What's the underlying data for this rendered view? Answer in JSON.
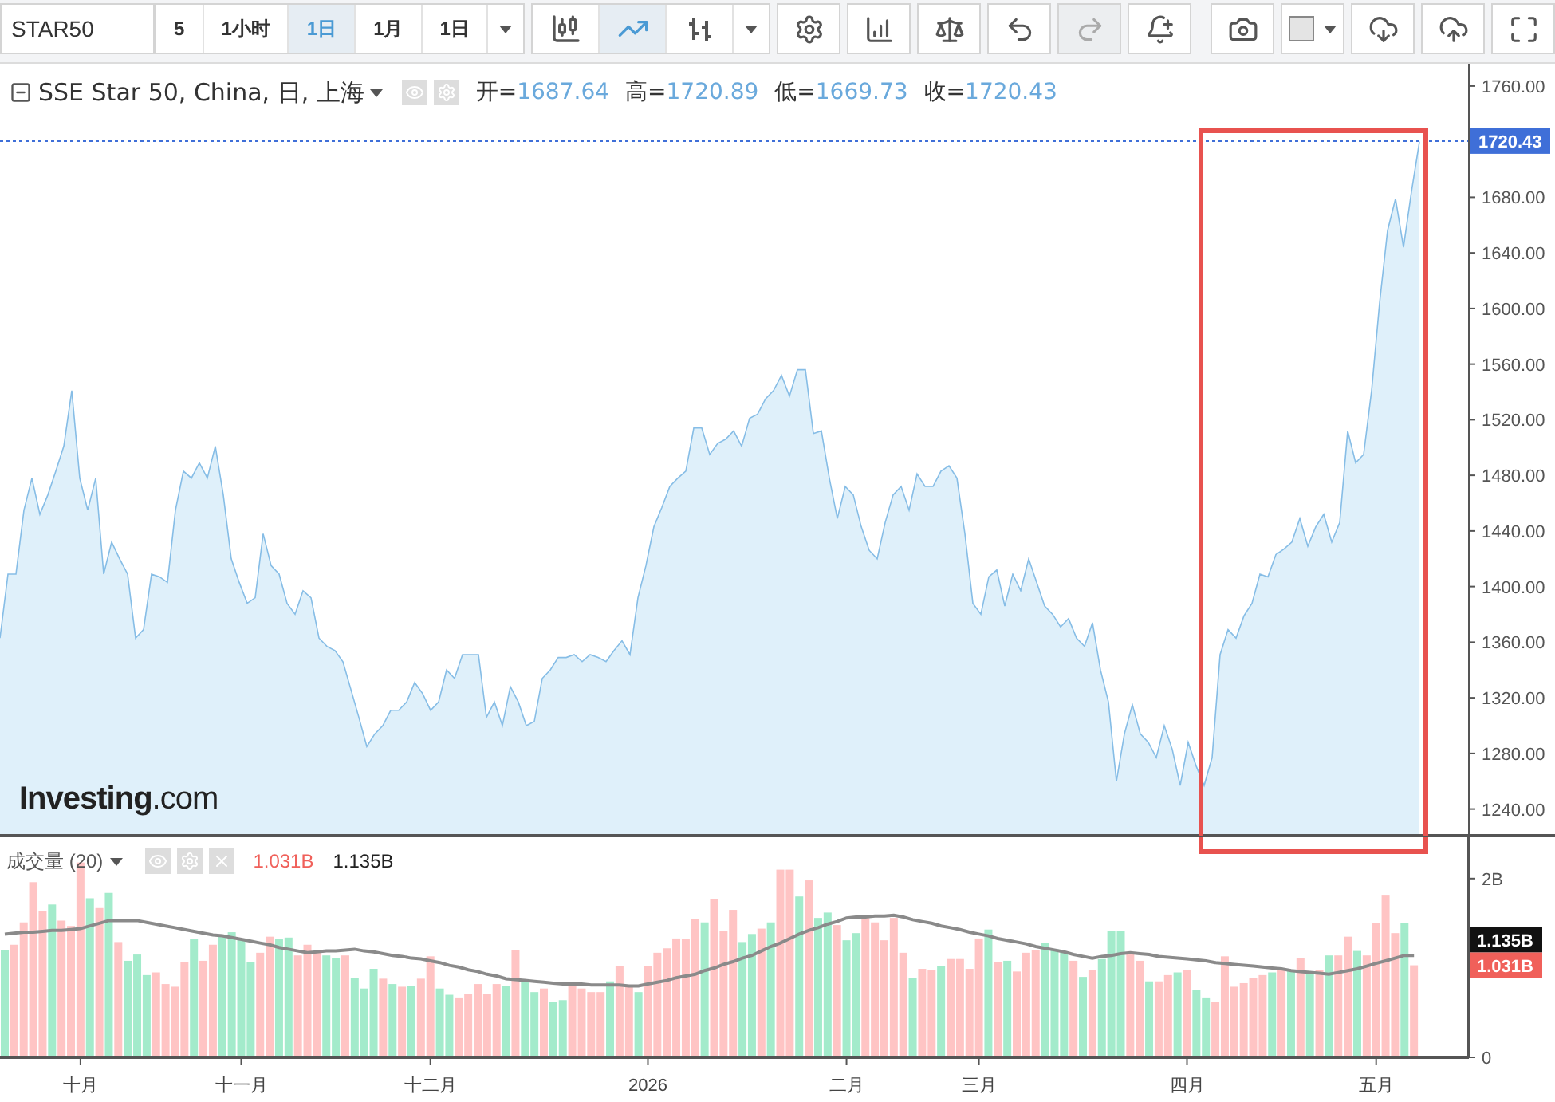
{
  "toolbar": {
    "symbol": "STAR50",
    "intervals": [
      {
        "label": "5",
        "selected": false
      },
      {
        "label": "1小时",
        "selected": false
      },
      {
        "label": "1日",
        "selected": true
      },
      {
        "label": "1月",
        "selected": false
      },
      {
        "label": "1日",
        "selected": false
      }
    ],
    "chart_types": [
      {
        "kind": "candles",
        "selected": false
      },
      {
        "kind": "line",
        "selected": true
      },
      {
        "kind": "bars",
        "selected": false
      }
    ],
    "tools_left": [
      {
        "kind": "settings",
        "disabled": false
      },
      {
        "kind": "indicators",
        "disabled": false
      },
      {
        "kind": "compare",
        "disabled": false
      },
      {
        "kind": "undo",
        "disabled": false
      },
      {
        "kind": "redo",
        "disabled": true
      },
      {
        "kind": "alert",
        "disabled": false
      }
    ],
    "tools_right": [
      {
        "kind": "snapshot",
        "disabled": false
      },
      {
        "kind": "color",
        "disabled": false
      },
      {
        "kind": "download",
        "disabled": false
      },
      {
        "kind": "upload",
        "disabled": false
      },
      {
        "kind": "fullscreen",
        "disabled": false
      }
    ]
  },
  "price_pane": {
    "legend": {
      "title": "SSE Star 50, China, 日, 上海",
      "ohlc": [
        {
          "label": "开=",
          "value": "1687.64"
        },
        {
          "label": "高=",
          "value": "1720.89"
        },
        {
          "label": "低=",
          "value": "1669.73"
        },
        {
          "label": "收=",
          "value": "1720.43"
        }
      ]
    },
    "logo": "**Investing**.com",
    "chart_data": {
      "type": "area",
      "ylim": [
        1222,
        1776
      ],
      "ref_lines": [
        {
          "axis": "y",
          "value": 1720.43,
          "label": "1720.43",
          "color": "#3f6fd8"
        }
      ],
      "yticks": [
        {
          "value": 1240,
          "label": "1240.00"
        },
        {
          "value": 1280,
          "label": "1280.00"
        },
        {
          "value": 1320,
          "label": "1320.00"
        },
        {
          "value": 1360,
          "label": "1360.00"
        },
        {
          "value": 1400,
          "label": "1400.00"
        },
        {
          "value": 1440,
          "label": "1440.00"
        },
        {
          "value": 1480,
          "label": "1480.00"
        },
        {
          "value": 1520,
          "label": "1520.00"
        },
        {
          "value": 1560,
          "label": "1560.00"
        },
        {
          "value": 1600,
          "label": "1600.00"
        },
        {
          "value": 1640,
          "label": "1640.00"
        },
        {
          "value": 1680,
          "label": "1680.00"
        },
        {
          "value": 1760,
          "label": "1760.00"
        }
      ],
      "series": [
        {
          "color": "#86bde6",
          "values": [
            1363,
            1409,
            1409,
            1455,
            1478,
            1452,
            1466,
            1483,
            1501,
            1541,
            1478,
            1455,
            1478,
            1409,
            1432,
            1420,
            1409,
            1363,
            1369,
            1409,
            1407,
            1403,
            1455,
            1483,
            1478,
            1489,
            1478,
            1501,
            1466,
            1420,
            1403,
            1388,
            1392,
            1438,
            1415,
            1409,
            1388,
            1380,
            1397,
            1392,
            1363,
            1357,
            1354,
            1346,
            1326,
            1306,
            1285,
            1294,
            1300,
            1311,
            1311,
            1317,
            1331,
            1323,
            1311,
            1317,
            1340,
            1334,
            1351,
            1351,
            1351,
            1306,
            1317,
            1300,
            1328,
            1317,
            1300,
            1303,
            1334,
            1340,
            1349,
            1349,
            1351,
            1346,
            1351,
            1349,
            1346,
            1354,
            1361,
            1351,
            1392,
            1415,
            1443,
            1457,
            1472,
            1478,
            1483,
            1514,
            1514,
            1495,
            1503,
            1506,
            1512,
            1501,
            1521,
            1524,
            1535,
            1541,
            1552,
            1537,
            1556,
            1556,
            1510,
            1512,
            1478,
            1449,
            1472,
            1466,
            1443,
            1426,
            1420,
            1446,
            1466,
            1472,
            1455,
            1481,
            1472,
            1472,
            1483,
            1487,
            1478,
            1438,
            1388,
            1380,
            1407,
            1412,
            1386,
            1409,
            1397,
            1420,
            1403,
            1386,
            1380,
            1371,
            1377,
            1363,
            1357,
            1374,
            1340,
            1317,
            1260,
            1294,
            1315,
            1294,
            1288,
            1277,
            1300,
            1283,
            1257,
            1288,
            1271,
            1257,
            1277,
            1351,
            1369,
            1363,
            1379,
            1388,
            1409,
            1407,
            1423,
            1427,
            1432,
            1449,
            1429,
            1443,
            1452,
            1432,
            1446,
            1512,
            1489,
            1495,
            1541,
            1604,
            1656,
            1679,
            1644,
            1684,
            1720
          ]
        }
      ]
    }
  },
  "volume_pane": {
    "legend": {
      "title": "成交量 (20)",
      "values": [
        {
          "text": "1.031B",
          "color": "#f0605a"
        },
        {
          "text": "1.135B",
          "color": "#222222"
        }
      ]
    },
    "axis_labels": [
      {
        "text": "1.135B",
        "color": "#111111",
        "kind": "average"
      },
      {
        "text": "1.031B",
        "color": "#f0605a",
        "kind": "volume"
      }
    ],
    "chart_data": {
      "type": "bar",
      "stacked": true,
      "ylim": [
        0,
        2.48
      ],
      "categories": [
        null,
        null,
        null,
        null,
        null,
        null,
        null,
        null,
        "十月",
        null,
        null,
        null,
        null,
        null,
        null,
        null,
        null,
        null,
        null,
        null,
        null,
        null,
        null,
        null,
        null,
        "十一月",
        null,
        null,
        null,
        null,
        null,
        null,
        null,
        null,
        null,
        null,
        null,
        null,
        null,
        null,
        null,
        null,
        null,
        null,
        null,
        "十二月",
        null,
        null,
        null,
        null,
        null,
        null,
        null,
        null,
        null,
        null,
        null,
        null,
        null,
        null,
        null,
        null,
        null,
        null,
        null,
        null,
        null,
        null,
        "2026",
        null,
        null,
        null,
        null,
        null,
        null,
        null,
        null,
        null,
        null,
        null,
        null,
        null,
        null,
        null,
        null,
        null,
        null,
        null,
        null,
        "二月",
        null,
        null,
        null,
        null,
        null,
        null,
        null,
        null,
        null,
        null,
        null,
        null,
        null,
        "三月",
        null,
        null,
        null,
        null,
        null,
        null,
        null,
        null,
        null,
        null,
        null,
        null,
        null,
        null,
        null,
        null,
        null,
        null,
        null,
        null,
        null,
        "四月",
        null,
        null,
        null,
        null,
        null,
        null,
        null,
        null,
        null,
        null,
        null,
        null,
        null,
        null,
        null,
        null,
        null,
        null,
        null,
        "五月",
        null,
        null,
        null,
        null
      ],
      "yticks": [
        {
          "value": 0,
          "label": "0"
        },
        {
          "value": 2,
          "label": "2B"
        }
      ],
      "series": [
        {
          "color": "#a3ebcb",
          "values": [
            1.2,
            null,
            null,
            null,
            null,
            1.71,
            null,
            null,
            null,
            1.78,
            null,
            1.84,
            null,
            1.08,
            1.15,
            0.92,
            null,
            null,
            null,
            null,
            1.32,
            null,
            null,
            1.35,
            1.4,
            1.32,
            1.07,
            null,
            null,
            1.32,
            1.34,
            null,
            null,
            null,
            1.14,
            1.11,
            null,
            0.89,
            0.77,
            0.99,
            null,
            0.82,
            null,
            0.8,
            null,
            null,
            0.77,
            0.7,
            null,
            null,
            null,
            null,
            null,
            0.8,
            null,
            0.85,
            0.73,
            null,
            0.62,
            0.64,
            null,
            null,
            null,
            null,
            0.85,
            null,
            null,
            0.73,
            null,
            null,
            null,
            null,
            null,
            null,
            1.51,
            null,
            null,
            null,
            1.29,
            1.38,
            null,
            1.51,
            null,
            null,
            1.8,
            null,
            1.56,
            1.62,
            null,
            1.31,
            1.39,
            null,
            null,
            null,
            null,
            null,
            0.89,
            null,
            null,
            1.02,
            null,
            null,
            null,
            null,
            1.43,
            null,
            1.08,
            null,
            null,
            null,
            1.28,
            1.21,
            1.18,
            null,
            0.9,
            null,
            1.1,
            1.41,
            1.41,
            null,
            null,
            0.85,
            null,
            null,
            0.95,
            null,
            0.75,
            0.67,
            null,
            null,
            null,
            null,
            null,
            null,
            0.95,
            null,
            0.98,
            null,
            0.96,
            null,
            1.14,
            null,
            null,
            1.19,
            null,
            null,
            null,
            null,
            1.5,
            null
          ]
        },
        {
          "color": "#ffc4c4",
          "values": [
            null,
            1.26,
            1.51,
            1.96,
            1.64,
            null,
            1.53,
            1.47,
            2.18,
            null,
            1.67,
            null,
            1.29,
            null,
            null,
            null,
            0.95,
            0.82,
            0.79,
            1.07,
            null,
            1.08,
            1.26,
            null,
            null,
            null,
            null,
            1.17,
            1.35,
            null,
            null,
            1.14,
            1.26,
            1.19,
            null,
            null,
            1.14,
            null,
            null,
            null,
            0.88,
            null,
            0.79,
            null,
            0.88,
            1.13,
            null,
            null,
            0.67,
            0.71,
            0.82,
            0.71,
            0.82,
            null,
            1.2,
            null,
            null,
            0.77,
            null,
            null,
            0.82,
            0.77,
            0.73,
            0.73,
            null,
            1.02,
            0.79,
            null,
            1.02,
            1.17,
            1.22,
            1.33,
            1.32,
            1.55,
            null,
            1.77,
            1.41,
            1.65,
            null,
            null,
            1.44,
            null,
            2.1,
            2.1,
            null,
            1.98,
            null,
            null,
            1.48,
            null,
            null,
            1.56,
            1.51,
            1.31,
            1.56,
            1.17,
            null,
            0.99,
            0.98,
            null,
            1.1,
            1.1,
            0.99,
            1.33,
            null,
            1.07,
            null,
            0.96,
            1.17,
            1.2,
            null,
            null,
            null,
            1.08,
            null,
            0.98,
            null,
            null,
            null,
            1.17,
            1.08,
            null,
            0.85,
            0.92,
            null,
            0.98,
            null,
            null,
            0.62,
            1.13,
            0.79,
            0.83,
            0.89,
            0.92,
            null,
            0.99,
            null,
            1.11,
            null,
            0.98,
            null,
            1.14,
            1.35,
            null,
            1.14,
            1.5,
            1.81,
            1.39,
            null,
            1.03
          ]
        }
      ]
    },
    "average": {
      "chart_data": {
        "type": "line",
        "ylim": [
          0,
          2.48
        ],
        "series": [
          {
            "color": "#8a8a8a",
            "values": [
              1.38,
              1.39,
              1.4,
              1.4,
              1.41,
              1.42,
              1.42,
              1.43,
              1.44,
              1.47,
              1.5,
              1.53,
              1.53,
              1.53,
              1.53,
              1.51,
              1.49,
              1.47,
              1.45,
              1.43,
              1.41,
              1.39,
              1.37,
              1.36,
              1.34,
              1.32,
              1.3,
              1.28,
              1.26,
              1.23,
              1.21,
              1.19,
              1.17,
              1.18,
              1.19,
              1.19,
              1.2,
              1.21,
              1.19,
              1.18,
              1.16,
              1.14,
              1.13,
              1.11,
              1.1,
              1.08,
              1.06,
              1.03,
              1.01,
              0.98,
              0.96,
              0.93,
              0.91,
              0.88,
              0.87,
              0.86,
              0.85,
              0.84,
              0.83,
              0.82,
              0.82,
              0.82,
              0.81,
              0.81,
              0.81,
              0.81,
              0.8,
              0.8,
              0.82,
              0.84,
              0.86,
              0.89,
              0.91,
              0.93,
              0.97,
              1.0,
              1.04,
              1.07,
              1.11,
              1.14,
              1.19,
              1.24,
              1.28,
              1.33,
              1.38,
              1.42,
              1.45,
              1.49,
              1.52,
              1.56,
              1.57,
              1.57,
              1.58,
              1.58,
              1.59,
              1.57,
              1.54,
              1.52,
              1.5,
              1.47,
              1.45,
              1.43,
              1.4,
              1.38,
              1.36,
              1.33,
              1.31,
              1.29,
              1.27,
              1.24,
              1.22,
              1.2,
              1.18,
              1.15,
              1.13,
              1.11,
              1.13,
              1.14,
              1.16,
              1.17,
              1.16,
              1.15,
              1.13,
              1.12,
              1.11,
              1.1,
              1.09,
              1.08,
              1.06,
              1.05,
              1.04,
              1.03,
              1.02,
              1.01,
              1.0,
              0.99,
              0.97,
              0.96,
              0.95,
              0.94,
              0.93,
              0.95,
              0.97,
              0.99,
              1.02,
              1.05,
              1.08,
              1.11,
              1.14,
              1.14
            ]
          }
        ]
      }
    }
  }
}
